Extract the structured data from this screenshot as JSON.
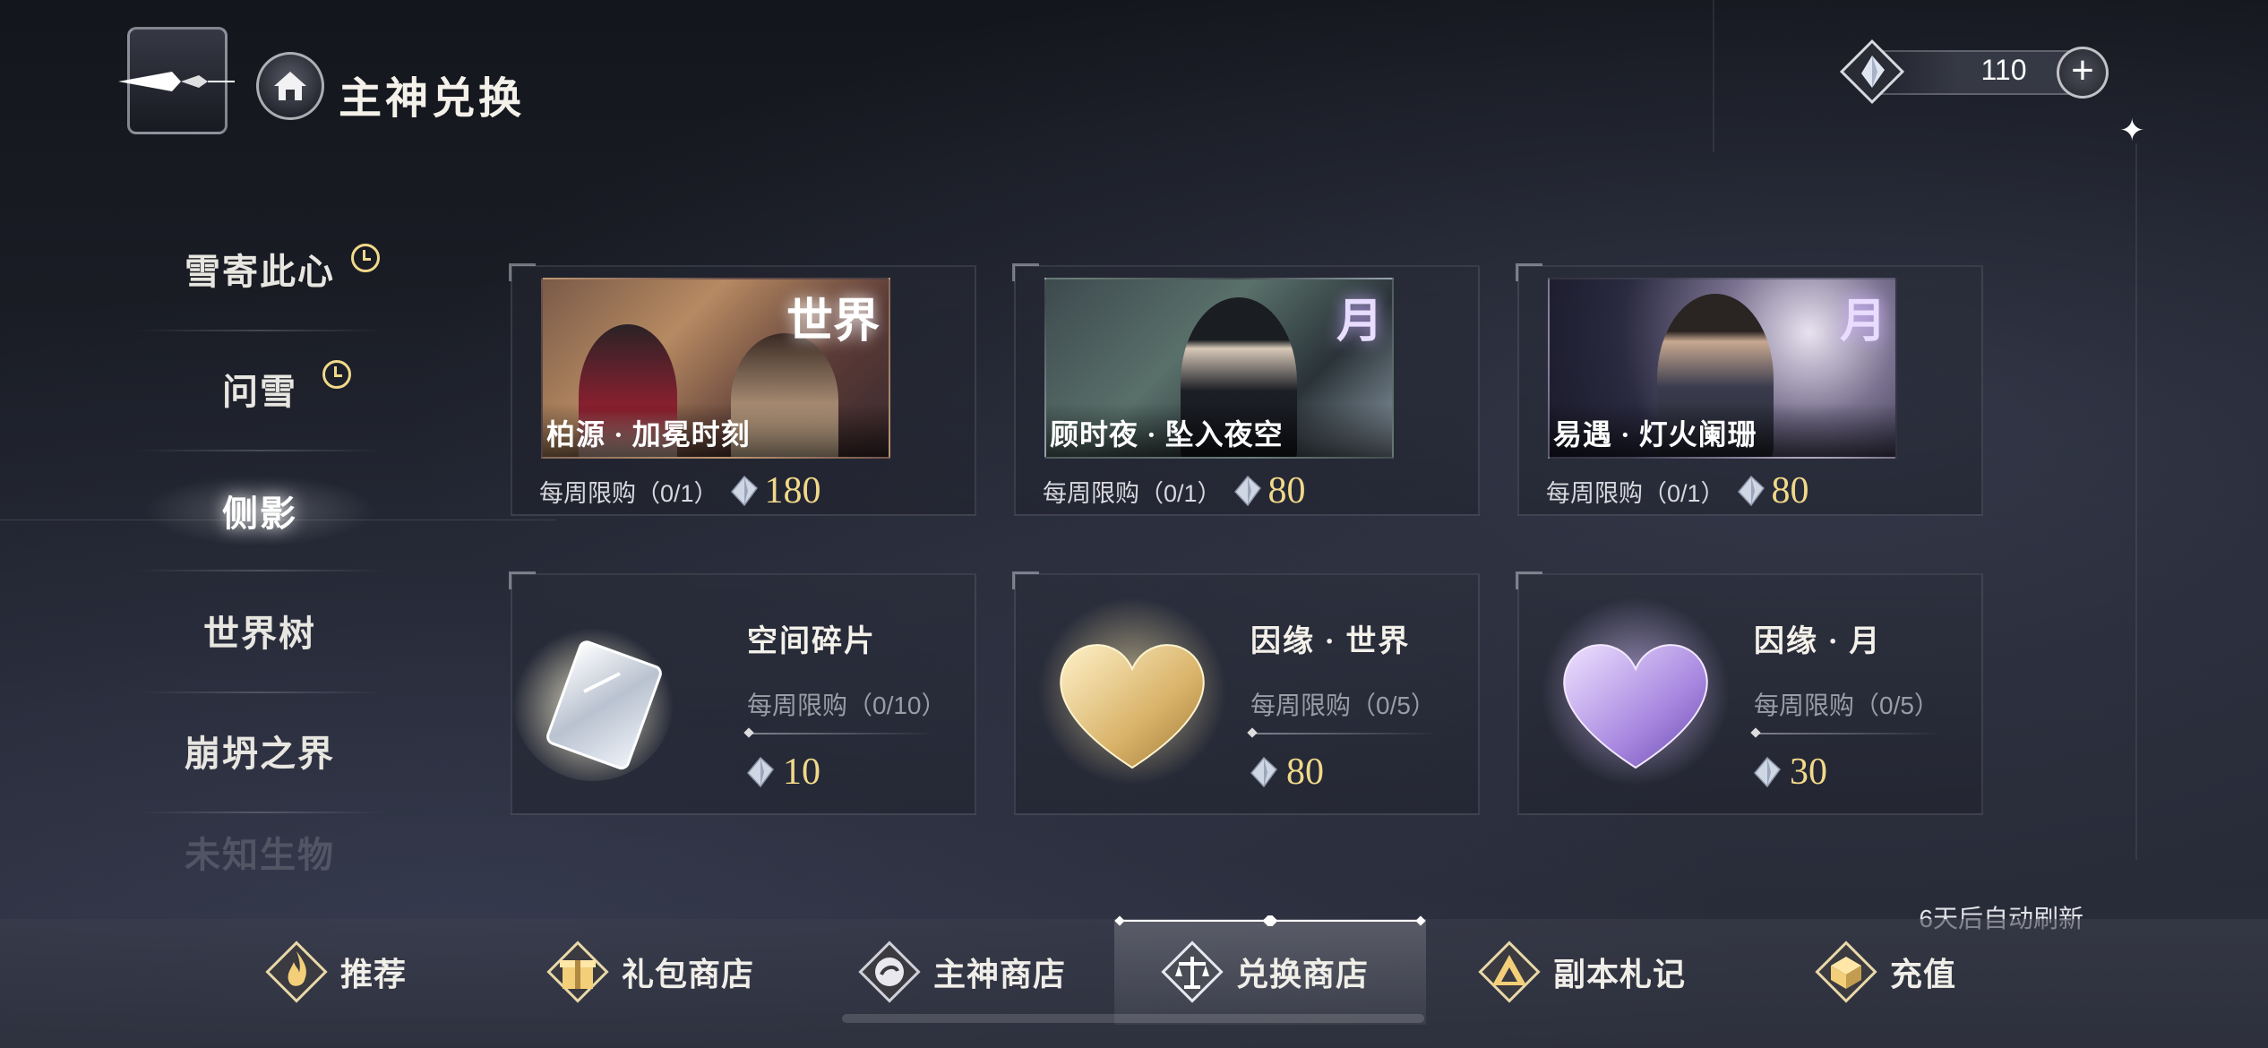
{
  "header": {
    "title": "主神兑换",
    "currency_value": "110"
  },
  "side_nav": {
    "items": [
      {
        "label": "雪寄此心",
        "timed": true
      },
      {
        "label": "问雪",
        "timed": true
      },
      {
        "label": "侧影",
        "active": true
      },
      {
        "label": "世界树"
      },
      {
        "label": "崩坍之界"
      },
      {
        "label": "未知生物"
      }
    ]
  },
  "cards_top": [
    {
      "title": "柏源 · 加冕时刻",
      "tag": "世界",
      "limit": "每周限购（0/1）",
      "price": "180"
    },
    {
      "title": "顾时夜 · 坠入夜空",
      "tag": "月",
      "limit": "每周限购（0/1）",
      "price": "80"
    },
    {
      "title": "易遇 · 灯火阑珊",
      "tag": "月",
      "limit": "每周限购（0/1）",
      "price": "80"
    }
  ],
  "cards_bottom": [
    {
      "name": "空间碎片",
      "limit": "每周限购（0/10）",
      "price": "10",
      "icon": "crystal-card-icon"
    },
    {
      "name": "因缘 · 世界",
      "limit": "每周限购（0/5）",
      "price": "80",
      "icon": "gold-heart-icon"
    },
    {
      "name": "因缘 · 月",
      "limit": "每周限购（0/5）",
      "price": "30",
      "icon": "purple-heart-icon"
    }
  ],
  "refresh_text": "6天后自动刷新",
  "tabs": [
    {
      "label": "推荐",
      "icon": "flame-icon"
    },
    {
      "label": "礼包商店",
      "icon": "gift-icon"
    },
    {
      "label": "主神商店",
      "icon": "emblem-icon"
    },
    {
      "label": "兑换商店",
      "icon": "scale-icon",
      "active": true
    },
    {
      "label": "副本札记",
      "icon": "triangle-icon"
    },
    {
      "label": "充值",
      "icon": "cube-icon"
    }
  ],
  "colors": {
    "gold": "#f1d98a",
    "text": "#f4f1ea",
    "muted": "#9a9ca6"
  }
}
